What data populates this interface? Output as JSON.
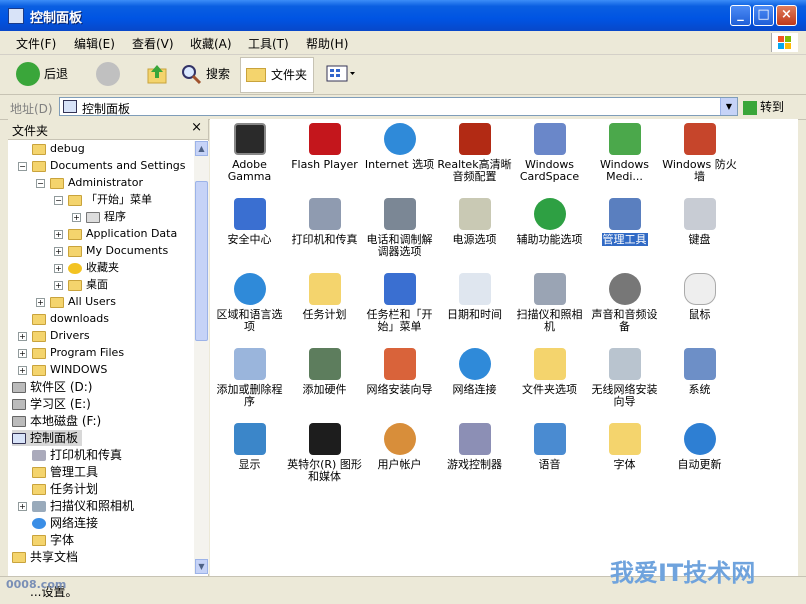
{
  "window": {
    "title": "控制面板"
  },
  "menu": [
    "文件(F)",
    "编辑(E)",
    "查看(V)",
    "收藏(A)",
    "工具(T)",
    "帮助(H)"
  ],
  "toolbar": {
    "back": "后退",
    "search": "搜索",
    "folders": "文件夹"
  },
  "address": {
    "label": "地址(D)",
    "value": "控制面板",
    "go": "转到"
  },
  "folders_panel": {
    "title": "文件夹"
  },
  "tree": [
    "debug",
    "Documents and Settings",
    "Administrator",
    "「开始」菜单",
    "程序",
    "Application Data",
    "My Documents",
    "收藏夹",
    "桌面",
    "All Users",
    "downloads",
    "Drivers",
    "Program Files",
    "WINDOWS",
    "软件区 (D:)",
    "学习区 (E:)",
    "本地磁盘 (F:)",
    "控制面板",
    "打印机和传真",
    "管理工具",
    "任务计划",
    "扫描仪和照相机",
    "网络连接",
    "字体",
    "共享文档"
  ],
  "icons": [
    "Adobe Gamma",
    "Flash Player",
    "Internet 选项",
    "Realtek高清晰音频配置",
    "Windows CardSpace",
    "Windows Medi...",
    "Windows 防火墙",
    "安全中心",
    "打印机和传真",
    "电话和调制解调器选项",
    "电源选项",
    "辅助功能选项",
    "管理工具",
    "键盘",
    "区域和语言选项",
    "任务计划",
    "任务栏和「开始」菜单",
    "日期和时间",
    "扫描仪和照相机",
    "声音和音频设备",
    "鼠标",
    "添加或删除程序",
    "添加硬件",
    "网络安装向导",
    "网络连接",
    "文件夹选项",
    "无线网络安装向导",
    "系统",
    "显示",
    "英特尔(R) 图形和媒体",
    "用户帐户",
    "游戏控制器",
    "语音",
    "字体",
    "自动更新"
  ],
  "status": {
    "text": "...设置。"
  },
  "watermark": {
    "left": "0008.com",
    "right": "我爱IT技术网"
  },
  "colors": {
    "titlebar": "#0054e3",
    "selection": "#316ac5",
    "folder": "#f4d46d"
  }
}
